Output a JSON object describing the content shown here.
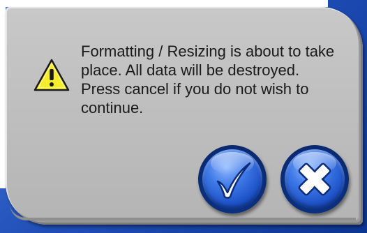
{
  "dialog": {
    "message_lines": [
      "Formatting / Resizing is about to take",
      "place. All data will be destroyed.",
      "Press cancel if you do not wish to",
      "continue."
    ],
    "icon": "warning-icon",
    "colors": {
      "panel": "#bdbdbd",
      "button_blue": "#1b4fc4",
      "warning_yellow": "#f6ee2a"
    }
  },
  "buttons": {
    "confirm_icon": "checkmark-icon",
    "cancel_icon": "close-icon"
  }
}
